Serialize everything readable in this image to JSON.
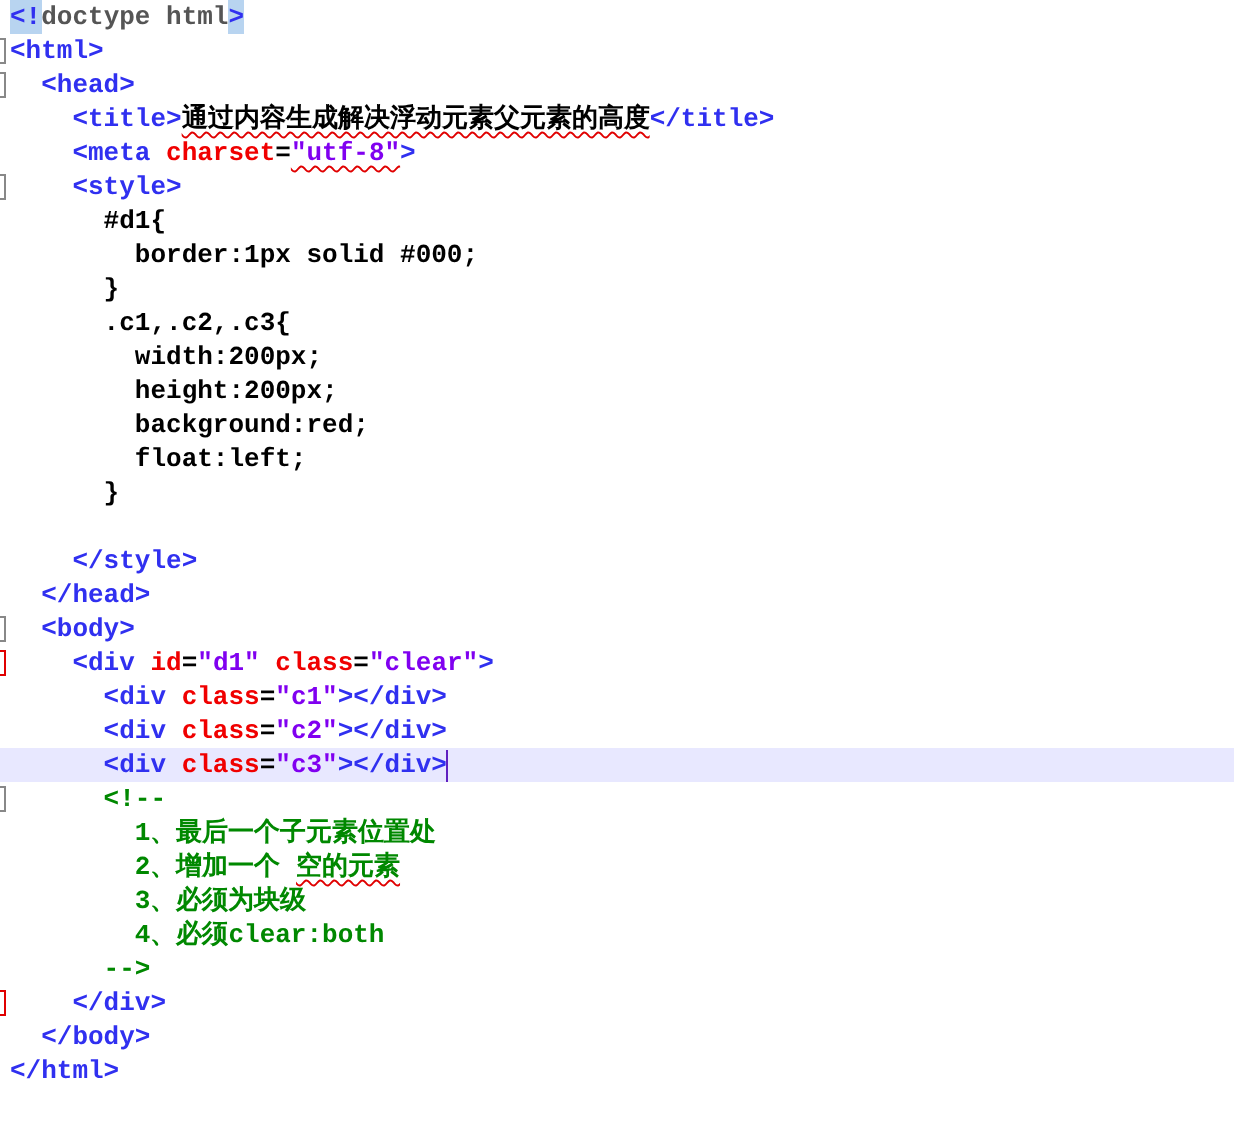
{
  "editor": {
    "lines": [
      {
        "tokens": [
          {
            "kind": "tag",
            "text": "<!",
            "matched": true
          },
          {
            "kind": "doctype",
            "text": "doctype html"
          },
          {
            "kind": "tag",
            "text": ">",
            "matched": true
          }
        ]
      },
      {
        "fold_marker": true,
        "tokens": [
          {
            "kind": "tag",
            "text": "<html>"
          }
        ]
      },
      {
        "fold_marker": true,
        "tokens": [
          {
            "kind": "tag",
            "text": "  <head>"
          }
        ]
      },
      {
        "tokens": [
          {
            "kind": "tag",
            "text": "    <title>"
          },
          {
            "kind": "text",
            "text": "通过内容生成解决浮动元素父元素的高度",
            "misspelled": true
          },
          {
            "kind": "tag",
            "text": "</title>"
          }
        ]
      },
      {
        "tokens": [
          {
            "kind": "tag",
            "text": "    <meta "
          },
          {
            "kind": "attr",
            "text": "charset"
          },
          {
            "kind": "text",
            "text": "="
          },
          {
            "kind": "value",
            "text": "\"utf-8\"",
            "misspelled": true
          },
          {
            "kind": "tag",
            "text": ">"
          }
        ]
      },
      {
        "fold_marker": true,
        "tokens": [
          {
            "kind": "tag",
            "text": "    <style>"
          }
        ]
      },
      {
        "tokens": [
          {
            "kind": "text",
            "text": "      #d1{"
          }
        ]
      },
      {
        "tokens": [
          {
            "kind": "text",
            "text": "        border:1px solid #000;"
          }
        ]
      },
      {
        "tokens": [
          {
            "kind": "text",
            "text": "      }"
          }
        ]
      },
      {
        "tokens": [
          {
            "kind": "text",
            "text": "      .c1,.c2,.c3{"
          }
        ]
      },
      {
        "tokens": [
          {
            "kind": "text",
            "text": "        width:200px;"
          }
        ]
      },
      {
        "tokens": [
          {
            "kind": "text",
            "text": "        height:200px;"
          }
        ]
      },
      {
        "tokens": [
          {
            "kind": "text",
            "text": "        background:red;"
          }
        ]
      },
      {
        "tokens": [
          {
            "kind": "text",
            "text": "        float:left;"
          }
        ]
      },
      {
        "tokens": [
          {
            "kind": "text",
            "text": "      }"
          }
        ]
      },
      {
        "blank": true
      },
      {
        "tokens": [
          {
            "kind": "tag",
            "text": "    </style>"
          }
        ]
      },
      {
        "tokens": [
          {
            "kind": "tag",
            "text": "  </head>"
          }
        ]
      },
      {
        "fold_marker": true,
        "tokens": [
          {
            "kind": "tag",
            "text": "  <body>"
          }
        ]
      },
      {
        "change_marker": true,
        "tokens": [
          {
            "kind": "tag",
            "text": "    <div "
          },
          {
            "kind": "attr",
            "text": "id"
          },
          {
            "kind": "text",
            "text": "="
          },
          {
            "kind": "value",
            "text": "\"d1\" "
          },
          {
            "kind": "attr",
            "text": "class"
          },
          {
            "kind": "text",
            "text": "="
          },
          {
            "kind": "value",
            "text": "\"clear\""
          },
          {
            "kind": "tag",
            "text": ">"
          }
        ]
      },
      {
        "tokens": [
          {
            "kind": "tag",
            "text": "      <div "
          },
          {
            "kind": "attr",
            "text": "class"
          },
          {
            "kind": "text",
            "text": "="
          },
          {
            "kind": "value",
            "text": "\"c1\""
          },
          {
            "kind": "tag",
            "text": "></div>"
          }
        ]
      },
      {
        "tokens": [
          {
            "kind": "tag",
            "text": "      <div "
          },
          {
            "kind": "attr",
            "text": "class"
          },
          {
            "kind": "text",
            "text": "="
          },
          {
            "kind": "value",
            "text": "\"c2\""
          },
          {
            "kind": "tag",
            "text": "></div>"
          }
        ]
      },
      {
        "current": true,
        "cursor_at_end": true,
        "tokens": [
          {
            "kind": "tag",
            "text": "      <div "
          },
          {
            "kind": "attr",
            "text": "class"
          },
          {
            "kind": "text",
            "text": "="
          },
          {
            "kind": "value",
            "text": "\"c3\""
          },
          {
            "kind": "tag",
            "text": "></div>"
          }
        ]
      },
      {
        "fold_marker": true,
        "tokens": [
          {
            "kind": "comment",
            "text": "      <!--"
          }
        ]
      },
      {
        "tokens": [
          {
            "kind": "comment",
            "text": "        1、最后一个子元素位置处"
          }
        ]
      },
      {
        "tokens": [
          {
            "kind": "comment",
            "text": "        2、增加一个 "
          },
          {
            "kind": "comment",
            "text": "空的元素",
            "misspelled": true
          }
        ]
      },
      {
        "tokens": [
          {
            "kind": "comment",
            "text": "        3、必须为块级"
          }
        ]
      },
      {
        "tokens": [
          {
            "kind": "comment",
            "text": "        4、必须clear:both"
          }
        ]
      },
      {
        "tokens": [
          {
            "kind": "comment",
            "text": "      -->"
          }
        ]
      },
      {
        "change_marker": true,
        "tokens": [
          {
            "kind": "tag",
            "text": "    </div>"
          }
        ]
      },
      {
        "tokens": [
          {
            "kind": "tag",
            "text": "  </body>"
          }
        ]
      },
      {
        "tokens": [
          {
            "kind": "tag",
            "text": "</html>"
          }
        ]
      }
    ]
  }
}
